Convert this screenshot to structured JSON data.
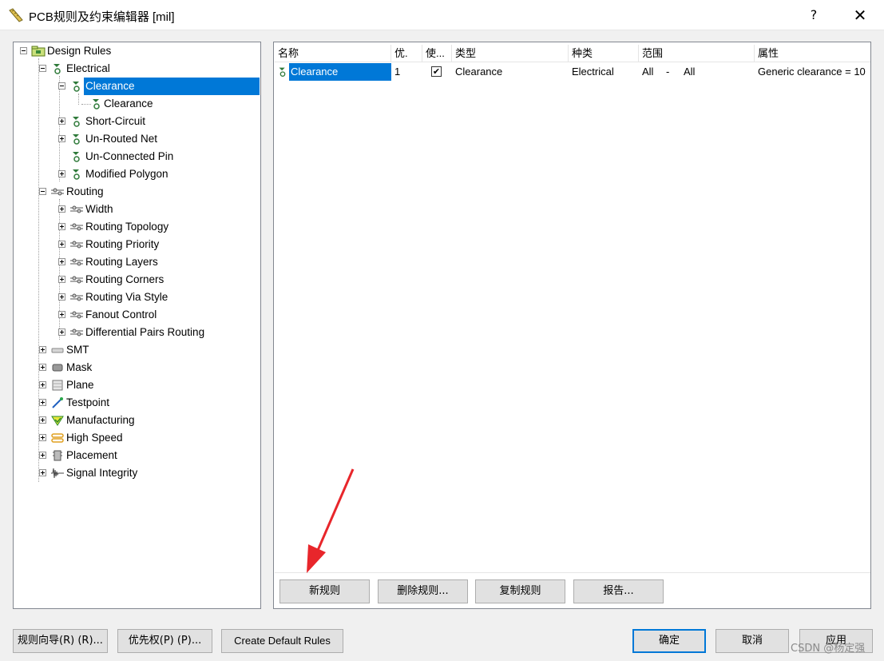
{
  "window": {
    "title": "PCB规则及约束编辑器 [mil]",
    "help_label": "?",
    "close_label": "✕"
  },
  "tree": {
    "root": "Design Rules",
    "electrical": "Electrical",
    "clearance_group": "Clearance",
    "clearance_rule": "Clearance",
    "short_circuit": "Short-Circuit",
    "unrouted_net": "Un-Routed Net",
    "unconnected_pin": "Un-Connected Pin",
    "modified_polygon": "Modified Polygon",
    "routing": "Routing",
    "width": "Width",
    "routing_topology": "Routing Topology",
    "routing_priority": "Routing Priority",
    "routing_layers": "Routing Layers",
    "routing_corners": "Routing Corners",
    "routing_via_style": "Routing Via Style",
    "fanout_control": "Fanout Control",
    "diff_pairs": "Differential Pairs Routing",
    "smt": "SMT",
    "mask": "Mask",
    "plane": "Plane",
    "testpoint": "Testpoint",
    "manufacturing": "Manufacturing",
    "high_speed": "High Speed",
    "placement": "Placement",
    "signal_integrity": "Signal Integrity"
  },
  "grid": {
    "headers": {
      "name": "名称",
      "priority": "优.",
      "enabled": "使...",
      "type": "类型",
      "category": "种类",
      "scope": "范围",
      "attributes": "属性"
    },
    "rows": [
      {
        "name": "Clearance",
        "priority": "1",
        "enabled": "✔",
        "type": "Clearance",
        "category": "Electrical",
        "scope_a": "All",
        "scope_dash": "-",
        "scope_b": "All",
        "attributes": "Generic clearance = 10"
      }
    ]
  },
  "buttons": {
    "new_rule": "新规则",
    "delete_rule": "删除规则...",
    "copy_rule": "复制规则",
    "report": "报告...",
    "rule_wizard": "规则向导(R) (R)...",
    "priority": "优先权(P) (P)...",
    "create_default": "Create Default Rules",
    "ok": "确定",
    "cancel": "取消",
    "apply": "应用"
  },
  "watermark": "CSDN @杨定强",
  "colors": {
    "selection": "#0078d7",
    "arrow": "#e8262b"
  }
}
